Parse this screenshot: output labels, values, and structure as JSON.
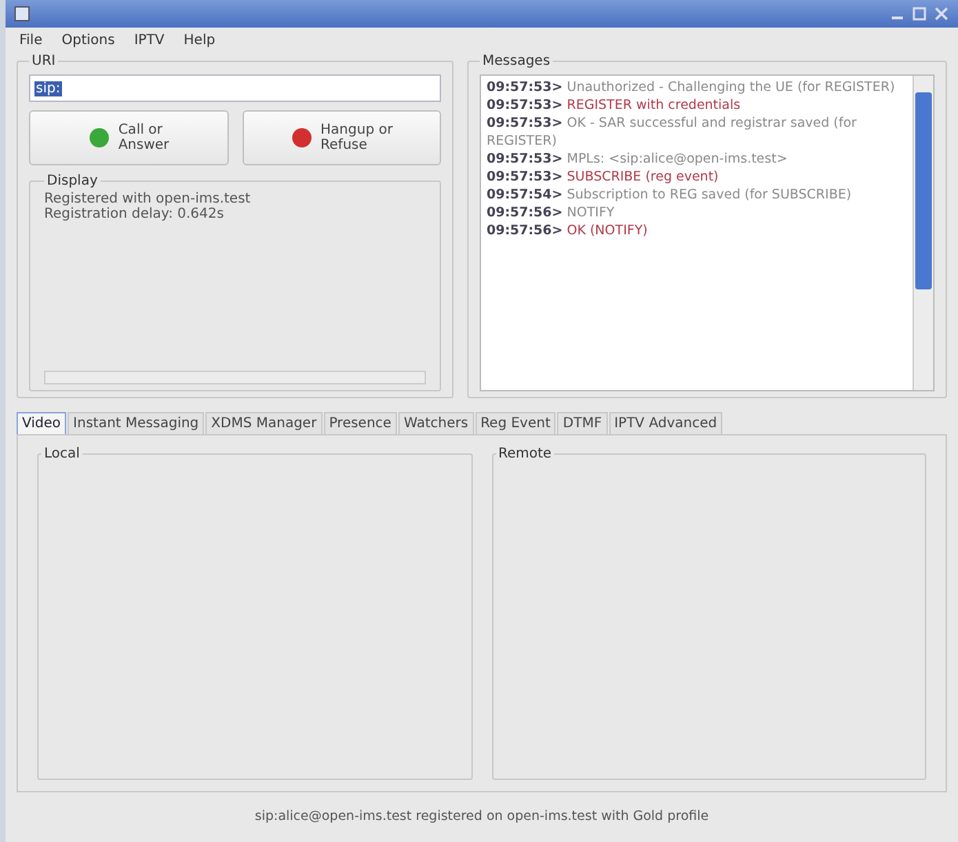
{
  "menu": [
    "File",
    "Options",
    "IPTV",
    "Help"
  ],
  "uri": {
    "label": "URI",
    "value": "sip:"
  },
  "call_buttons": [
    {
      "label": "Call or\nAnswer",
      "color": "#3aa83a"
    },
    {
      "label": "Hangup or\nRefuse",
      "color": "#d23030"
    }
  ],
  "display": {
    "title": "Display",
    "lines": [
      "Registered with open-ims.test",
      "Registration delay: 0.642s"
    ]
  },
  "messages": {
    "title": "Messages",
    "items": [
      {
        "time": "09:57:53>",
        "text": "Unauthorized - Challenging the UE (for REGISTER)",
        "color": "#8a8a8a"
      },
      {
        "time": "09:57:53>",
        "text": "REGISTER with credentials",
        "color": "#b03a4a"
      },
      {
        "time": "09:57:53>",
        "text": "OK - SAR successful and registrar saved (for REGISTER)",
        "color": "#8a8a8a"
      },
      {
        "time": "09:57:53>",
        "text": "MPLs: <sip:alice@open-ims.test>",
        "color": "#8a8a8a"
      },
      {
        "time": "09:57:53>",
        "text": "SUBSCRIBE (reg event)",
        "color": "#b03a4a"
      },
      {
        "time": "09:57:54>",
        "text": "Subscription to REG saved (for SUBSCRIBE)",
        "color": "#8a8a8a"
      },
      {
        "time": "09:57:56>",
        "text": "NOTIFY",
        "color": "#8a8a8a"
      },
      {
        "time": "09:57:56>",
        "text": "OK (NOTIFY)",
        "color": "#b03a4a"
      }
    ]
  },
  "tabs": [
    {
      "label": "Video",
      "selected": true
    },
    {
      "label": "Instant Messaging",
      "selected": false
    },
    {
      "label": "XDMS Manager",
      "selected": false
    },
    {
      "label": "Presence",
      "selected": false
    },
    {
      "label": "Watchers",
      "selected": false
    },
    {
      "label": "Reg Event",
      "selected": false
    },
    {
      "label": "DTMF",
      "selected": false
    },
    {
      "label": "IPTV Advanced",
      "selected": false
    }
  ],
  "video": {
    "local": "Local",
    "remote": "Remote"
  },
  "status_bar": "sip:alice@open-ims.test registered on open-ims.test with Gold profile"
}
